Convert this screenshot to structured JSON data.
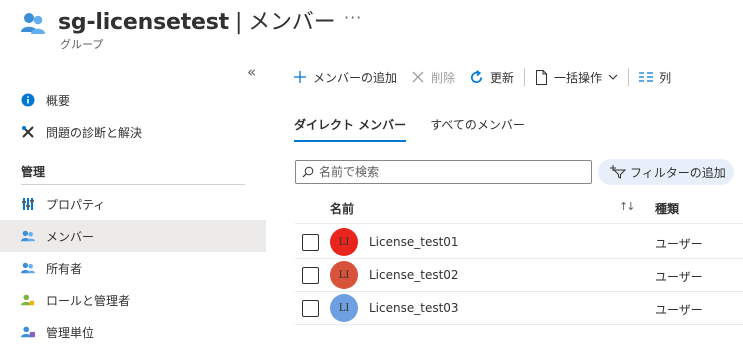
{
  "header": {
    "title": "sg-licensetest",
    "separator": "|",
    "page": "メンバー",
    "more": "···",
    "subtitle": "グループ"
  },
  "sidebar": {
    "collapse": "«",
    "items": [
      {
        "label": "概要",
        "icon": "info-icon"
      },
      {
        "label": "問題の診断と解決",
        "icon": "wrench-icon"
      }
    ],
    "section": "管理",
    "manage_items": [
      {
        "label": "プロパティ",
        "icon": "properties-icon"
      },
      {
        "label": "メンバー",
        "icon": "members-icon",
        "active": true
      },
      {
        "label": "所有者",
        "icon": "owners-icon"
      },
      {
        "label": "ロールと管理者",
        "icon": "roles-icon"
      },
      {
        "label": "管理単位",
        "icon": "admin-units-icon"
      }
    ]
  },
  "toolbar": {
    "add_member": "メンバーの追加",
    "delete": "削除",
    "refresh": "更新",
    "bulk": "一括操作",
    "columns": "列"
  },
  "tabs": [
    {
      "label": "ダイレクト メンバー",
      "active": true
    },
    {
      "label": "すべてのメンバー",
      "active": false
    }
  ],
  "search": {
    "placeholder": "名前で検索"
  },
  "filter": {
    "label": "フィルターの追加"
  },
  "table": {
    "columns": {
      "name": "名前",
      "type": "種類"
    },
    "rows": [
      {
        "initials": "LI",
        "name": "License_test01",
        "type": "ユーザー",
        "color": "#e8251c"
      },
      {
        "initials": "LI",
        "name": "License_test02",
        "type": "ユーザー",
        "color": "#d9533a"
      },
      {
        "initials": "LI",
        "name": "License_test03",
        "type": "ユーザー",
        "color": "#6e9fe0"
      }
    ]
  },
  "colors": {
    "accent": "#0078d4",
    "active_nav": "#edebe9",
    "filter_pill": "#e7f0fa"
  }
}
